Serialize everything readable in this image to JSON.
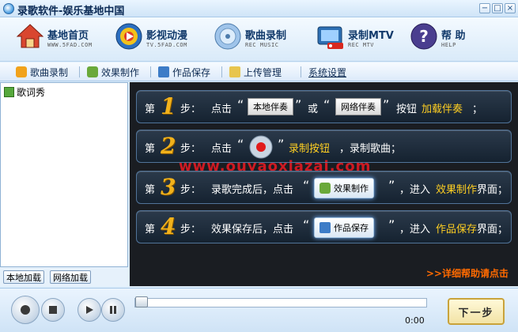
{
  "window": {
    "title": "录歌软件-娱乐基地中国",
    "controls": [
      "−",
      "□",
      "×"
    ],
    "tool_indicator": "▼▼▼"
  },
  "nav": [
    {
      "title": "基地首页",
      "sub": "WWW.5FAD.COM",
      "icon": "home-icon"
    },
    {
      "title": "影视动漫",
      "sub": "TV.5FAD.COM",
      "icon": "video-icon"
    },
    {
      "title": "歌曲录制",
      "sub": "REC MUSIC",
      "icon": "cd-record-icon"
    },
    {
      "title": "录制MTV",
      "sub": "REC MTV",
      "icon": "mtv-record-icon"
    },
    {
      "title": "帮   助",
      "sub": "HELP",
      "icon": "help-icon"
    }
  ],
  "subtoolbar": [
    "歌曲录制",
    "效果制作",
    "作品保存",
    "上传管理",
    "系统设置"
  ],
  "left": {
    "tree_item": "歌词秀",
    "btn_local": "本地加载",
    "btn_net": "网络加载"
  },
  "steps": {
    "di": "第",
    "bu": "步：",
    "s1": {
      "num": "1",
      "text1": "点击",
      "btn1": "本地伴奏",
      "or": "或",
      "btn2": "网络伴奏",
      "text2": "按钮",
      "hl": "加载伴奏",
      "end": "；"
    },
    "s2": {
      "num": "2",
      "text1": "点击",
      "hl": "录制按钮",
      "text2": "，录制歌曲；"
    },
    "s3": {
      "num": "3",
      "text1": "录歌完成后，点击",
      "btn": "效果制作",
      "text2": "，进入",
      "hl": "效果制作",
      "text3": "界面；"
    },
    "s4": {
      "num": "4",
      "text1": "效果保存后，点击",
      "btn": "作品保存",
      "text2": "，进入",
      "hl": "作品保存",
      "text3": "界面；"
    },
    "quote_open": "“",
    "quote_close": "”"
  },
  "watermark": "www.ouyaoxiazai.com",
  "help_link": ">>详细帮助请点击",
  "player": {
    "time": "0:00",
    "next": "下一步"
  }
}
